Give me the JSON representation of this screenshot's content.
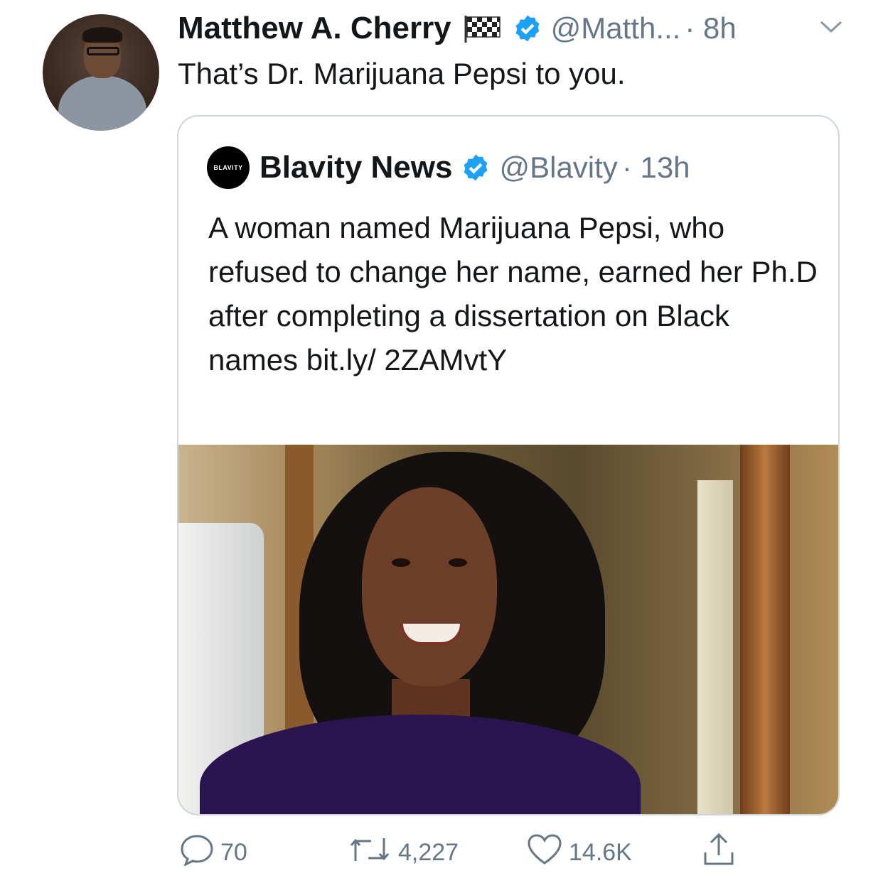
{
  "tweet": {
    "author_name": "Matthew A. Cherry",
    "author_handle": "@Matth...",
    "time": "· 8h",
    "text": "That’s Dr. Marijuana Pepsi to you."
  },
  "quoted": {
    "logo_text": "BLAVITY",
    "author_name": "Blavity News",
    "author_handle": "@Blavity",
    "time": "· 13h",
    "text": "A woman named Marijuana Pepsi, who refused to change her name, earned her Ph.D after completing a dissertation on Black names bit.ly/ 2ZAMvtY"
  },
  "actions": {
    "reply_count": "70",
    "retweet_count": "4,227",
    "like_count": "14.6K"
  },
  "colors": {
    "verified": "#1da1f2",
    "secondary_text": "#657786",
    "border": "#ccd6dd"
  },
  "icons": [
    "verified-badge-icon",
    "checkered-flag-icon",
    "chevron-down-icon",
    "reply-icon",
    "retweet-icon",
    "like-icon",
    "share-icon"
  ]
}
